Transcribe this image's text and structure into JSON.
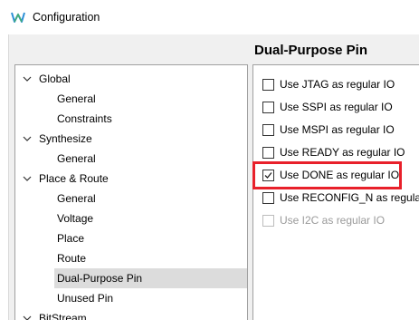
{
  "window": {
    "title": "Configuration",
    "icon": "gowin-logo-icon"
  },
  "tree": [
    {
      "label": "Global",
      "level": 0,
      "expanded": true
    },
    {
      "label": "General",
      "level": 1
    },
    {
      "label": "Constraints",
      "level": 1
    },
    {
      "label": "Synthesize",
      "level": 0,
      "expanded": true
    },
    {
      "label": "General",
      "level": 1
    },
    {
      "label": "Place & Route",
      "level": 0,
      "expanded": true
    },
    {
      "label": "General",
      "level": 1
    },
    {
      "label": "Voltage",
      "level": 1
    },
    {
      "label": "Place",
      "level": 1
    },
    {
      "label": "Route",
      "level": 1
    },
    {
      "label": "Dual-Purpose Pin",
      "level": 1,
      "selected": true
    },
    {
      "label": "Unused Pin",
      "level": 1
    },
    {
      "label": "BitStream",
      "level": 0,
      "expanded": true
    }
  ],
  "panel": {
    "title": "Dual-Purpose Pin",
    "options": [
      {
        "label": "Use JTAG as regular IO",
        "checked": false,
        "enabled": true
      },
      {
        "label": "Use SSPI as regular IO",
        "checked": false,
        "enabled": true
      },
      {
        "label": "Use MSPI as regular IO",
        "checked": false,
        "enabled": true
      },
      {
        "label": "Use READY as regular IO",
        "checked": false,
        "enabled": true
      },
      {
        "label": "Use DONE as regular IO",
        "checked": true,
        "enabled": true
      },
      {
        "label": "Use RECONFIG_N as regular IO",
        "checked": false,
        "enabled": true
      },
      {
        "label": "Use I2C as regular IO",
        "checked": false,
        "enabled": false
      }
    ]
  },
  "highlight_color": "#e8202a"
}
